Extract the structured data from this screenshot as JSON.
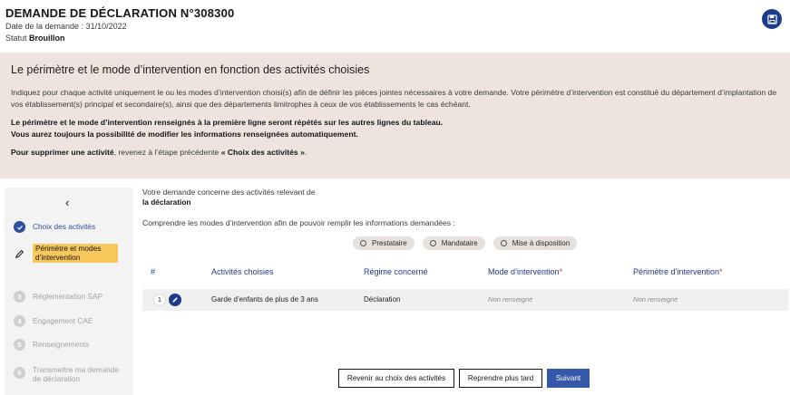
{
  "header": {
    "title": "DEMANDE DE DÉCLARATION N°308300",
    "date_label": "Date de la demande : ",
    "date_value": "31/10/2022",
    "status_label": "Statut ",
    "status_value": "Brouillon",
    "save_icon": "floppy-disk-icon"
  },
  "info": {
    "heading": "Le périmètre et le mode d’intervention en fonction des activités choisies",
    "paragraph1": "Indiquez pour chaque activité uniquement le ou les modes d’intervention choisi(s) afin de définir les pièces jointes nécessaires à votre demande. Votre périmètre d’intervention est constitué du département d’implantation de vos établissement(s) principal et secondaire(s), ainsi que des départements limitrophes à ceux de vos établissements le cas échéant.",
    "bold_line1": "Le périmètre et le mode d’intervention renseignés à la première ligne seront répétés sur les autres lignes du tableau.",
    "bold_line2": "Vous aurez toujours la possibilité de modifier les informations renseignées automatiquement.",
    "delete_prefix": "Pour supprimer une activité",
    "delete_middle": ", revenez à l’étape précédente ",
    "delete_link": "« Choix des activités »",
    "delete_suffix": "."
  },
  "sidebar": {
    "collapse_icon": "chevron-left-icon",
    "steps": [
      {
        "label": "Choix des activités",
        "state": "done"
      },
      {
        "label": "Périmètre et modes d’intervention",
        "state": "current"
      },
      {
        "number": "3",
        "label": "Réglementation SAP",
        "state": "todo"
      },
      {
        "number": "4",
        "label": "Engagement CAE",
        "state": "todo"
      },
      {
        "number": "5",
        "label": "Renseignements",
        "state": "todo"
      },
      {
        "number": "6",
        "label": "Transmettre ma demande de déclaration",
        "state": "todo"
      }
    ]
  },
  "main": {
    "concern_text": "Votre demande concerne des activités relevant de",
    "concern_bold": "la déclaration",
    "understand_text": "Comprendre les modes d’intervention afin de pouvoir remplir les informations demandées :",
    "chips": [
      "Prestataire",
      "Mandataire",
      "Mise à disposition"
    ],
    "table": {
      "headers": [
        "#",
        "Activités choisies",
        "Régime concerné",
        "Mode d’intervention",
        "Périmètre d’intervention"
      ],
      "required_mark": "*",
      "rows": [
        {
          "num": "1",
          "activity": "Garde d’enfants de plus de 3 ans",
          "regime": "Déclaration",
          "mode": "Non renseigné",
          "perimetre": "Non renseigné"
        }
      ]
    }
  },
  "buttons": {
    "back": "Revenir au choix des activités",
    "later": "Reprendre plus tard",
    "next": "Suivant"
  }
}
